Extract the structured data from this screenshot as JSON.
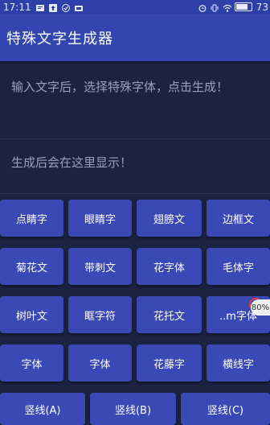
{
  "status_bar": {
    "time": "17:11",
    "battery": "73",
    "icons": [
      "message-icon",
      "upload-icon",
      "check-icon",
      "signal-icon",
      "alarm-icon",
      "vibrate-icon",
      "wifi-icon",
      "battery-icon"
    ]
  },
  "app": {
    "title": "特殊文字生成器"
  },
  "input": {
    "placeholder": "输入文字后，选择特殊字体，点击生成！"
  },
  "output": {
    "placeholder": "生成后会在这里显示！"
  },
  "buttons": [
    "点睛字",
    "眼睛字",
    "翅膀文",
    "边框文",
    "菊花文",
    "带刺文",
    "花字体",
    "毛体字",
    "树叶文",
    "眶字符",
    "花托文",
    "..m字体",
    "字体",
    "字体",
    "花藤字",
    "横线字",
    "竖线(A)",
    "竖线(B)",
    "竖线(C)"
  ],
  "overlay_badge": "80%",
  "colors": {
    "status_bar": "#2f3fa8",
    "app_bar": "#3245b0",
    "background": "#1c2340",
    "button": "#3a49b5"
  }
}
